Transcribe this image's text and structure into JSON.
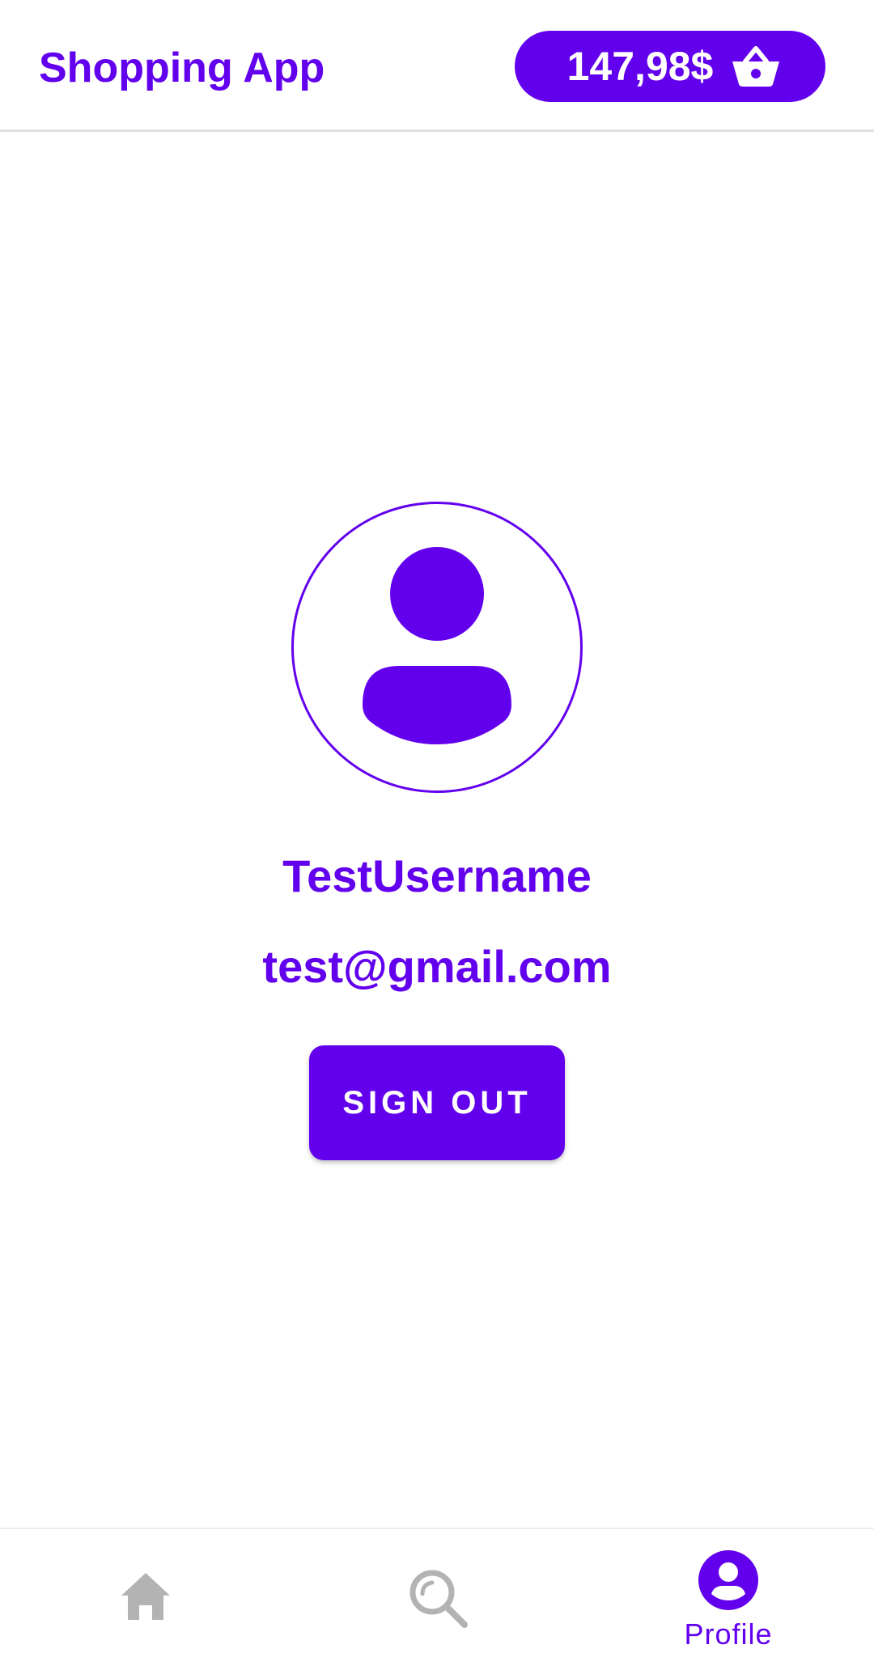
{
  "header": {
    "title": "Shopping App",
    "cart_total": "147,98$",
    "cart_icon": "basket-icon"
  },
  "profile": {
    "avatar_icon": "person-icon",
    "username": "TestUsername",
    "email": "test@gmail.com",
    "sign_out_label": "SIGN OUT"
  },
  "bottom_nav": {
    "items": [
      {
        "icon": "home-icon",
        "label": "",
        "selected": false
      },
      {
        "icon": "search-icon",
        "label": "",
        "selected": false
      },
      {
        "icon": "profile-icon",
        "label": "Profile",
        "selected": true
      }
    ]
  },
  "colors": {
    "primary": "#6200ee",
    "inactive": "#b3b3b3",
    "background": "#ffffff"
  }
}
